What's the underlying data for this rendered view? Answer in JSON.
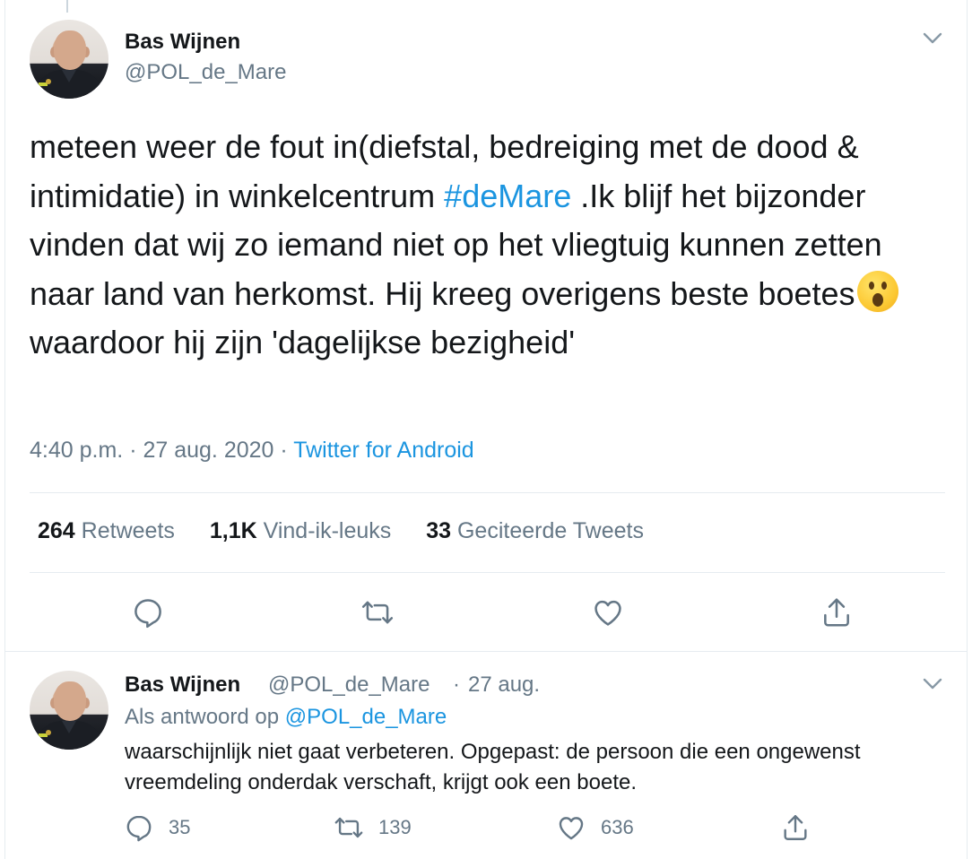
{
  "main_tweet": {
    "author_name": "Bas Wijnen",
    "author_handle": "@POL_de_Mare",
    "text_before_hashtag": "meteen weer de fout in(diefstal, bedreiging met de dood & intimidatie) in winkelcentrum ",
    "hashtag": "#deMare",
    "text_after_hashtag": " .Ik blijf het bijzonder vinden dat wij zo iemand niet op het vliegtuig kunnen zetten naar land van herkomst. Hij kreeg overigens beste boetes",
    "emoji": "hushed-face-emoji",
    "text_after_emoji": "waardoor hij zijn 'dagelijkse bezigheid'",
    "time": "4:40 p.m.",
    "date": "27 aug. 2020",
    "separator": "·",
    "source": "Twitter for Android",
    "stats": {
      "retweets_count": "264",
      "retweets_label": "Retweets",
      "likes_count": "1,1K",
      "likes_label": "Vind-ik-leuks",
      "quotes_count": "33",
      "quotes_label": "Geciteerde Tweets"
    },
    "action_icons": [
      "reply-icon",
      "retweet-icon",
      "like-icon",
      "share-icon"
    ],
    "menu_icon": "chevron-down-icon"
  },
  "reply_tweet": {
    "author_name": "Bas Wijnen",
    "author_handle": "@POL_de_Mare",
    "separator": "·",
    "date": "27 aug.",
    "reply_to_label": "Als antwoord op",
    "reply_to_handle": "@POL_de_Mare",
    "text": "waarschijnlijk niet gaat verbeteren. Opgepast: de persoon die een ongewenst vreemdeling onderdak verschaft, krijgt ook een boete.",
    "reply_count": "35",
    "retweet_count": "139",
    "like_count": "636",
    "menu_icon": "chevron-down-icon"
  },
  "colors": {
    "link": "#1b95e0",
    "secondary_text": "#657786",
    "primary_text": "#14171a",
    "divider": "#e6ecf0"
  }
}
